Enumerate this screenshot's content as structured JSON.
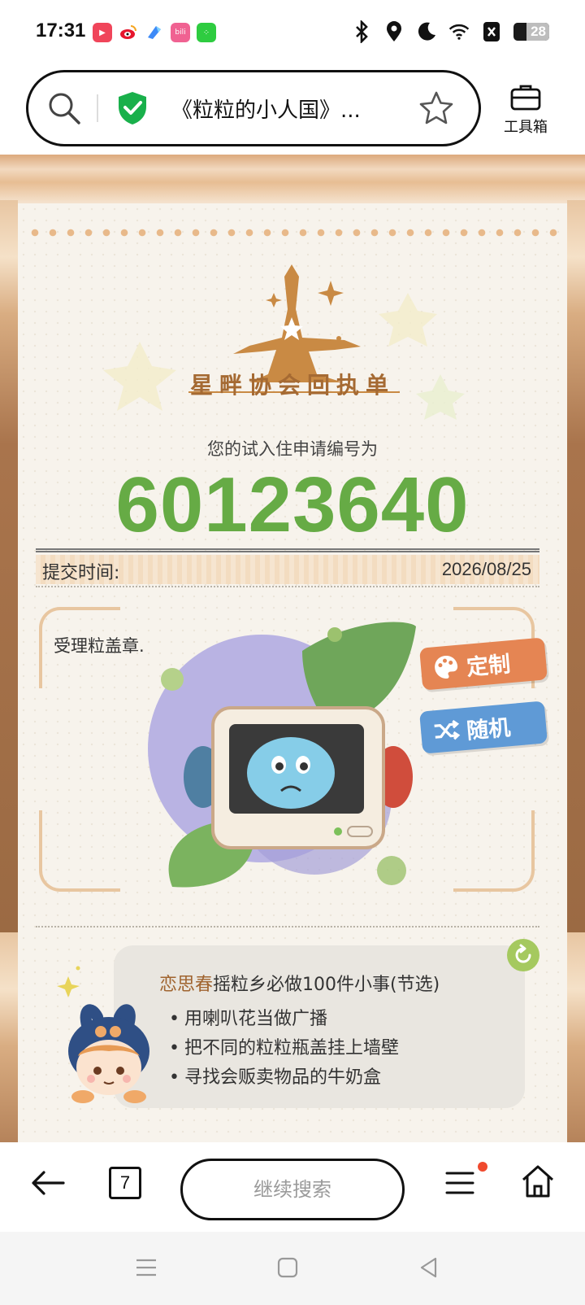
{
  "status_bar": {
    "time": "17:31",
    "battery": "28",
    "apps": [
      {
        "name": "video-app-icon",
        "color": "#f0455a",
        "glyph": "▶"
      },
      {
        "name": "weibo-icon",
        "color": "#f5a623",
        "glyph": "◉"
      },
      {
        "name": "browser-app-icon",
        "color": "#3d8af7",
        "glyph": "◆"
      },
      {
        "name": "bilibili-icon",
        "color": "#f06292",
        "glyph": "bili"
      },
      {
        "name": "green-app-icon",
        "color": "#2ecc40",
        "glyph": "⁘"
      }
    ]
  },
  "address_bar": {
    "url_title": "《粒粒的小人国》...",
    "toolbox_label": "工具箱"
  },
  "page": {
    "logo_title": "星畔协会回执单",
    "subtitle": "您的试入住申请编号为",
    "application_number": "60123640",
    "submit_time_label": "提交时间:",
    "submit_time_value": "2026/08/25",
    "stamp_label": "受理粒盖章.",
    "custom_button": "定制",
    "random_button": "随机",
    "tips_name": "恋思春",
    "tips_title": "摇粒乡必做100件小事(节选)",
    "tips_items": [
      "用喇叭花当做广播",
      "把不同的粒粒瓶盖挂上墙壁",
      "寻找会贩卖物品的牛奶盒"
    ]
  },
  "bottom_bar": {
    "tab_count": "7",
    "search_placeholder": "继续搜索"
  },
  "colors": {
    "accent_green": "#66ab45",
    "logo_brown": "#c98a44",
    "custom_orange": "#e58553",
    "random_blue": "#5f9ad6",
    "notify_red": "#f04a2e"
  }
}
